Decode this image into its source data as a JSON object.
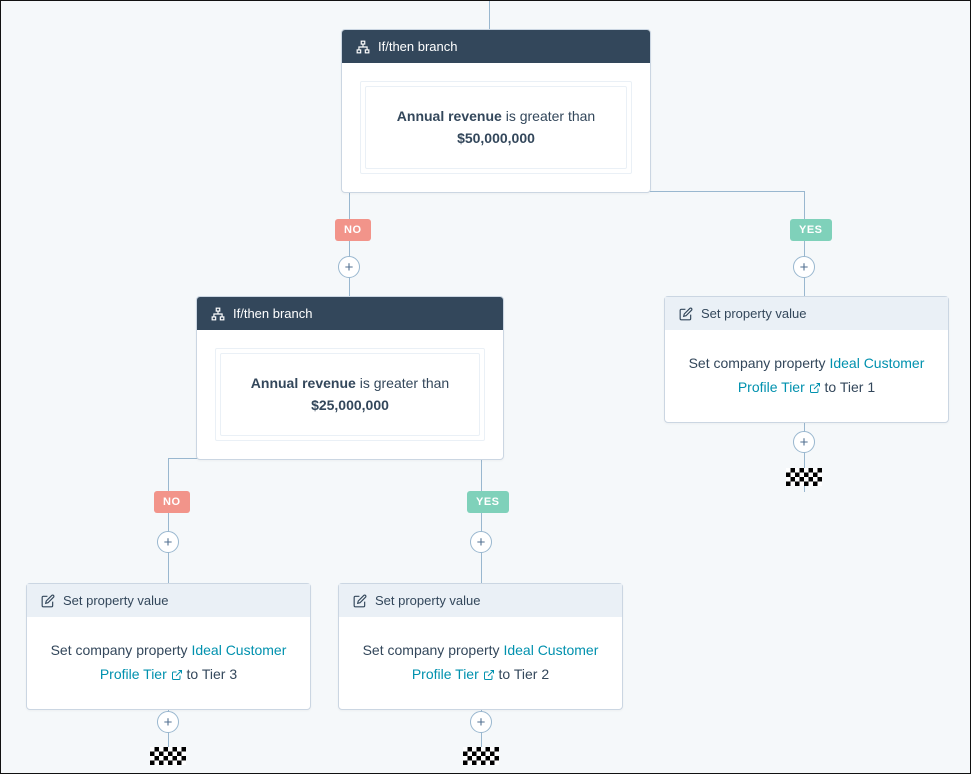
{
  "labels": {
    "if_then_branch": "If/then branch",
    "set_property_value": "Set property value",
    "no": "NO",
    "yes": "YES"
  },
  "branch1": {
    "property_label": "Annual revenue",
    "operator": "is greater than",
    "value": "$50,000,000"
  },
  "branch2": {
    "property_label": "Annual revenue",
    "operator": "is greater than",
    "value": "$25,000,000"
  },
  "action_tier1": {
    "prefix": "Set company property",
    "link_label": "Ideal Customer Profile Tier",
    "to": "to",
    "value": "Tier 1"
  },
  "action_tier2": {
    "prefix": "Set company property",
    "link_label": "Ideal Customer Profile Tier",
    "to": "to",
    "value": "Tier 2"
  },
  "action_tier3": {
    "prefix": "Set company property",
    "link_label": "Ideal Customer Profile Tier",
    "to": "to",
    "value": "Tier 3"
  }
}
